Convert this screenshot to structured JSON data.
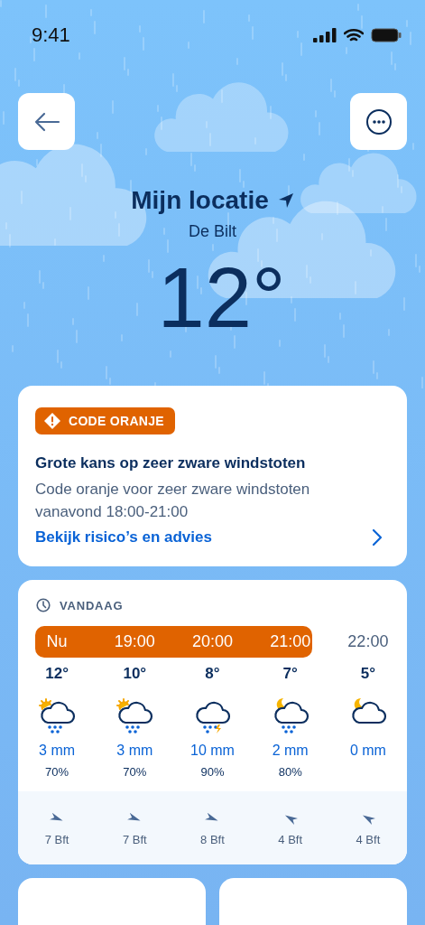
{
  "status_bar": {
    "time": "9:41"
  },
  "location": {
    "title": "Mijn locatie",
    "place": "De Bilt",
    "temperature": "12°"
  },
  "warning": {
    "badge": "CODE ORANJE",
    "color": "#e06300",
    "title": "Grote kans op zeer zware windstoten",
    "body": "Code oranje voor zeer zware windstoten vanavond 18:00-21:00",
    "link": "Bekijk risico’s en advies"
  },
  "hourly": {
    "heading": "VANDAAG",
    "hours": [
      {
        "time": "Nu",
        "warning": true,
        "temp": "12°",
        "kind": "sunrain",
        "rain": "3 mm",
        "chance": "70%",
        "wind": {
          "kind": "southeast",
          "force": "7 Bft"
        }
      },
      {
        "time": "19:00",
        "warning": true,
        "temp": "10°",
        "kind": "sunrain",
        "rain": "3 mm",
        "chance": "70%",
        "wind": {
          "kind": "southeast",
          "force": "7 Bft"
        }
      },
      {
        "time": "20:00",
        "warning": true,
        "temp": "8°",
        "kind": "thunder",
        "rain": "10 mm",
        "chance": "90%",
        "wind": {
          "kind": "southeast",
          "force": "8 Bft"
        }
      },
      {
        "time": "21:00",
        "warning": true,
        "temp": "7°",
        "kind": "moonrain",
        "rain": "2 mm",
        "chance": "80%",
        "wind": {
          "kind": "northwest",
          "force": "4 Bft"
        }
      },
      {
        "time": "22:00",
        "warning": false,
        "temp": "5°",
        "kind": "mooncloud",
        "rain": "0 mm",
        "wind": {
          "kind": "northwest",
          "force": "4 Bft"
        }
      }
    ]
  }
}
